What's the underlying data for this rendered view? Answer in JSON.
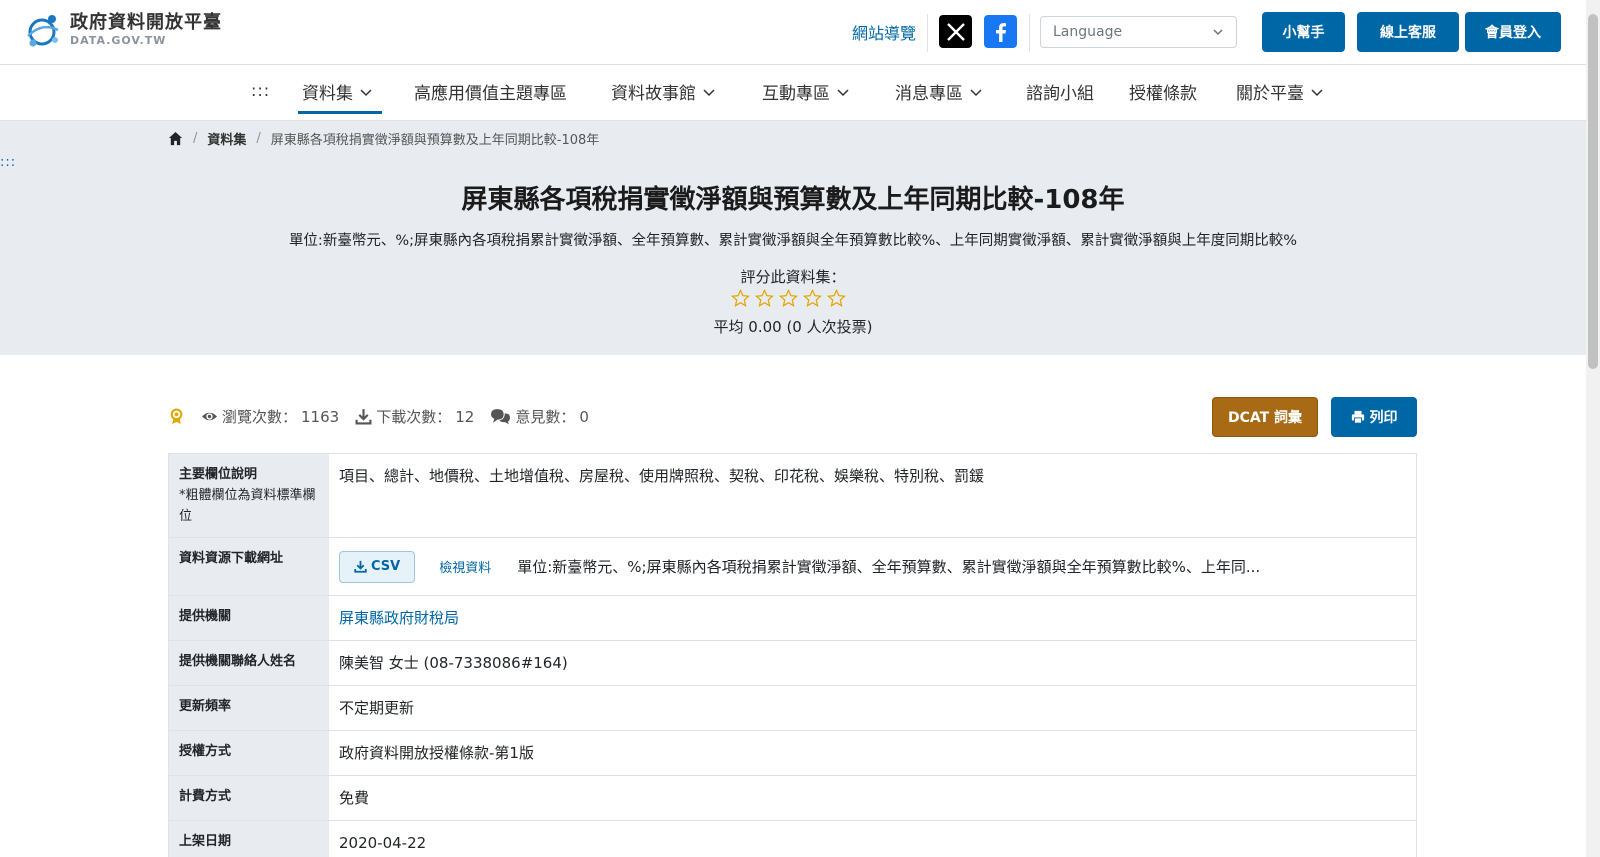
{
  "header": {
    "logo_title": "政府資料開放平臺",
    "logo_sub": "DATA.GOV.TW",
    "sitemap": "網站導覽",
    "language_placeholder": "Language",
    "helper": "小幫手",
    "online_service": "線上客服",
    "login": "會員登入"
  },
  "nav": {
    "dots": ":::",
    "items": [
      {
        "label": "資料集"
      },
      {
        "label": "高應用價值主題專區"
      },
      {
        "label": "資料故事館"
      },
      {
        "label": "互動專區"
      },
      {
        "label": "消息專區"
      },
      {
        "label": "諮詢小組"
      },
      {
        "label": "授權條款"
      },
      {
        "label": "關於平臺"
      }
    ]
  },
  "hero": {
    "left_dots": ":::",
    "breadcrumb": {
      "dataset": "資料集",
      "current": "屏東縣各項稅捐實徵淨額與預算數及上年同期比較-108年"
    },
    "title": "屏東縣各項稅捐實徵淨額與預算數及上年同期比較-108年",
    "description": "單位:新臺幣元、%;屏東縣內各項稅捐累計實徵淨額、全年預算數、累計實徵淨額與全年預算數比較%、上年同期實徵淨額、累計實徵淨額與上年度同期比較%",
    "rating_label": "評分此資料集：",
    "rating_value": 0,
    "rating_max": 5,
    "rating_avg": "平均 0.00 (0 人次投票)"
  },
  "stats": {
    "views_label": "瀏覽次數：",
    "views": "1163",
    "downloads_label": "下載次數：",
    "downloads": "12",
    "comments_label": "意見數：",
    "comments": "0",
    "dcat": "DCAT 詞彙",
    "print": "列印"
  },
  "info": {
    "fields_label": "主要欄位說明",
    "fields_note": "*粗體欄位為資料標準欄位",
    "fields_value": "項目、總計、地價稅、土地增值稅、房屋稅、使用牌照稅、契稅、印花稅、娛樂稅、特別稅、罰鍰",
    "resource_label": "資料資源下載網址",
    "csv": "CSV",
    "view_data": "檢視資料",
    "resource_desc": "單位:新臺幣元、%;屏東縣內各項稅捐累計實徵淨額、全年預算數、累計實徵淨額與全年預算數比較%、上年同...",
    "agency_label": "提供機關",
    "agency": "屏東縣政府財稅局",
    "contact_label": "提供機關聯絡人姓名",
    "contact": "陳美智 女士 (08-7338086#164)",
    "frequency_label": "更新頻率",
    "frequency": "不定期更新",
    "license_label": "授權方式",
    "license": "政府資料開放授權條款-第1版",
    "fee_label": "計費方式",
    "fee": "免費",
    "date_label": "上架日期",
    "date": "2020-04-22"
  },
  "colors": {
    "primary": "#0067a6",
    "dcat": "#a86a14",
    "hero_bg": "#e8ecf1",
    "star": "#e0a800"
  }
}
